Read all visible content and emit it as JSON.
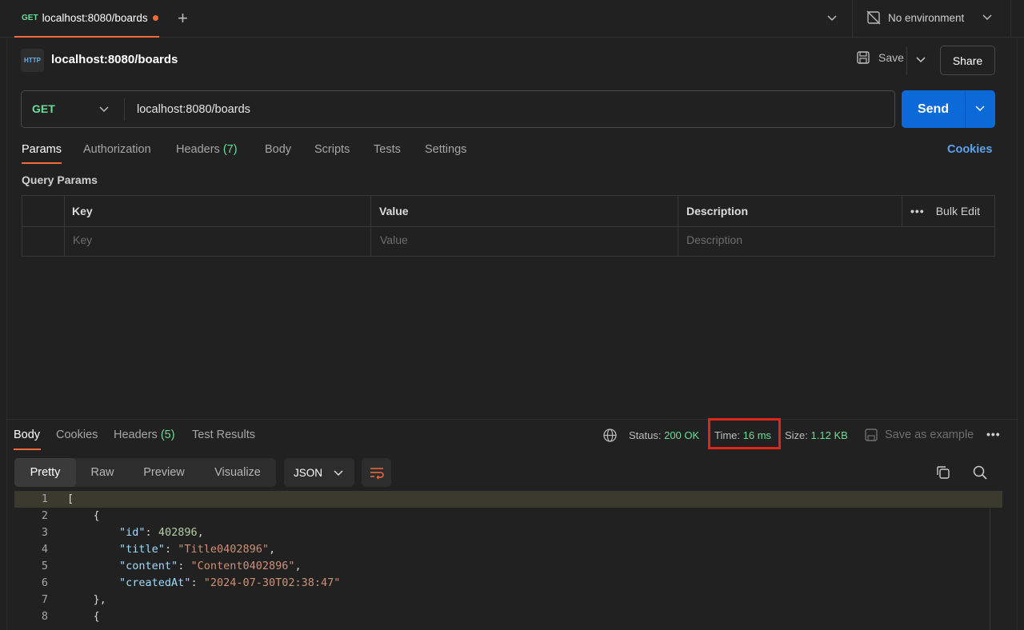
{
  "tabbar": {
    "tab": {
      "method": "GET",
      "name": "localhost:8080/boards"
    },
    "environment": "No environment"
  },
  "request": {
    "icon_label": "HTTP",
    "title": "localhost:8080/boards",
    "save_label": "Save",
    "share_label": "Share",
    "method": "GET",
    "url": "localhost:8080/boards",
    "send_label": "Send",
    "tabs": [
      {
        "label": "Params"
      },
      {
        "label": "Authorization"
      },
      {
        "label": "Headers",
        "count": "(7)"
      },
      {
        "label": "Body"
      },
      {
        "label": "Scripts"
      },
      {
        "label": "Tests"
      },
      {
        "label": "Settings"
      }
    ],
    "cookies_label": "Cookies",
    "query_params_label": "Query Params",
    "params_table": {
      "headers": [
        "Key",
        "Value",
        "Description"
      ],
      "placeholders": [
        "Key",
        "Value",
        "Description"
      ],
      "bulk_edit_label": "Bulk Edit"
    }
  },
  "response": {
    "tabs": [
      {
        "label": "Body"
      },
      {
        "label": "Cookies"
      },
      {
        "label": "Headers",
        "count": "(5)"
      },
      {
        "label": "Test Results"
      }
    ],
    "status_label": "Status:",
    "status_value": "200 OK",
    "time_label": "Time:",
    "time_value": "16 ms",
    "size_label": "Size:",
    "size_value": "1.12 KB",
    "save_example_label": "Save as example",
    "view_modes": [
      "Pretty",
      "Raw",
      "Preview",
      "Visualize"
    ],
    "format": "JSON",
    "code_lines": [
      {
        "n": "1"
      },
      {
        "n": "2"
      },
      {
        "n": "3"
      },
      {
        "n": "4"
      },
      {
        "n": "5"
      },
      {
        "n": "6"
      },
      {
        "n": "7"
      },
      {
        "n": "8"
      }
    ],
    "body": {
      "id_key": "\"id\"",
      "id_val": "402896",
      "title_key": "\"title\"",
      "title_val": "\"Title0402896\"",
      "content_key": "\"content\"",
      "content_val": "\"Content0402896\"",
      "created_key": "\"createdAt\"",
      "created_val": "\"2024-07-30T02:38:47\""
    }
  },
  "colors": {
    "accent": "#f26b3a",
    "send": "#0b6ad8",
    "ok_green": "#6bdd9a",
    "highlight": "#e0251b"
  }
}
